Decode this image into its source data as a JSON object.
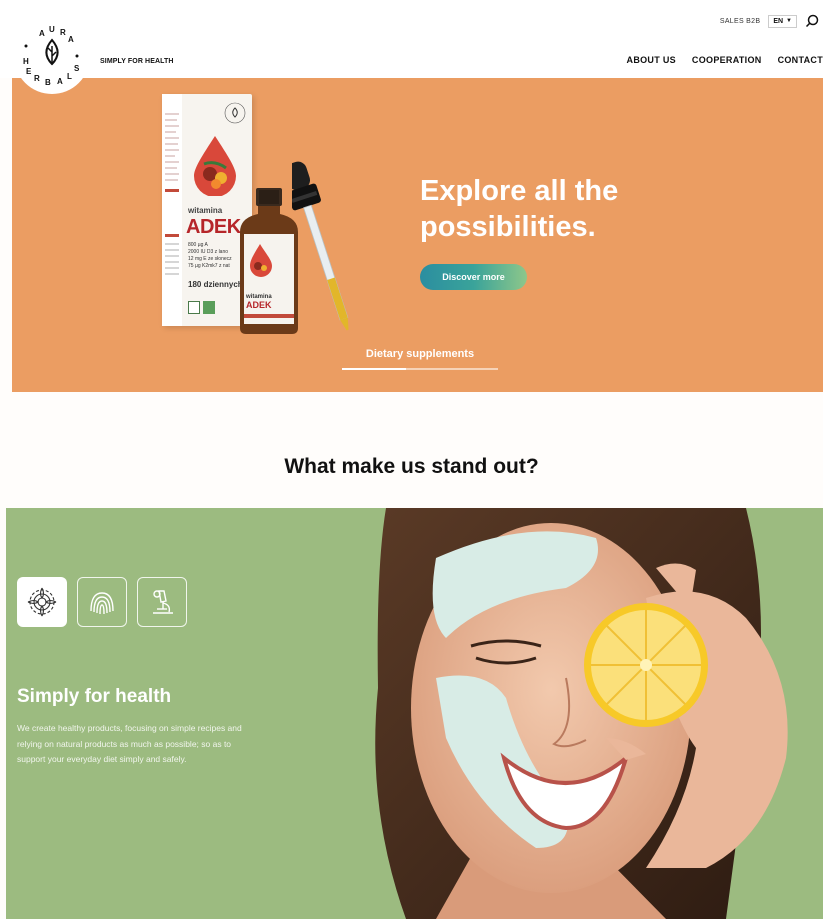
{
  "header": {
    "logo_text": "AURA HERBALS",
    "tagline": "SIMPLY FOR HEALTH",
    "sales_label": "SALES B2B",
    "lang_label": "EN",
    "nav": [
      "ABOUT US",
      "COOPERATION",
      "CONTACT"
    ]
  },
  "hero": {
    "title_line1": "Explore all the",
    "title_line2": "possibilities.",
    "button_label": "Discover more",
    "tab_label": "Dietary supplements",
    "background_color": "#eb9d62",
    "product": {
      "box_line1": "witamina",
      "box_line2": "ADEK",
      "box_dose": "800 µg A\n2000 IU D3 z lano\n12 mg E ze słonecz\n75 µg K2mk7 z nat",
      "box_count": "180 dziennych p",
      "bottle_line1": "witamina",
      "bottle_line2": "ADEK"
    }
  },
  "standout": {
    "heading": "What make us stand out?"
  },
  "feature": {
    "icons": [
      {
        "name": "mandala-icon",
        "active": true
      },
      {
        "name": "fingerprint-icon",
        "active": false
      },
      {
        "name": "microscope-icon",
        "active": false
      }
    ],
    "title": "Simply for health",
    "text": "We create healthy products, focusing on simple recipes and relying on natural products as much as possible; so as to support your everyday diet simply and safely.",
    "background_color": "#9cbb80"
  }
}
